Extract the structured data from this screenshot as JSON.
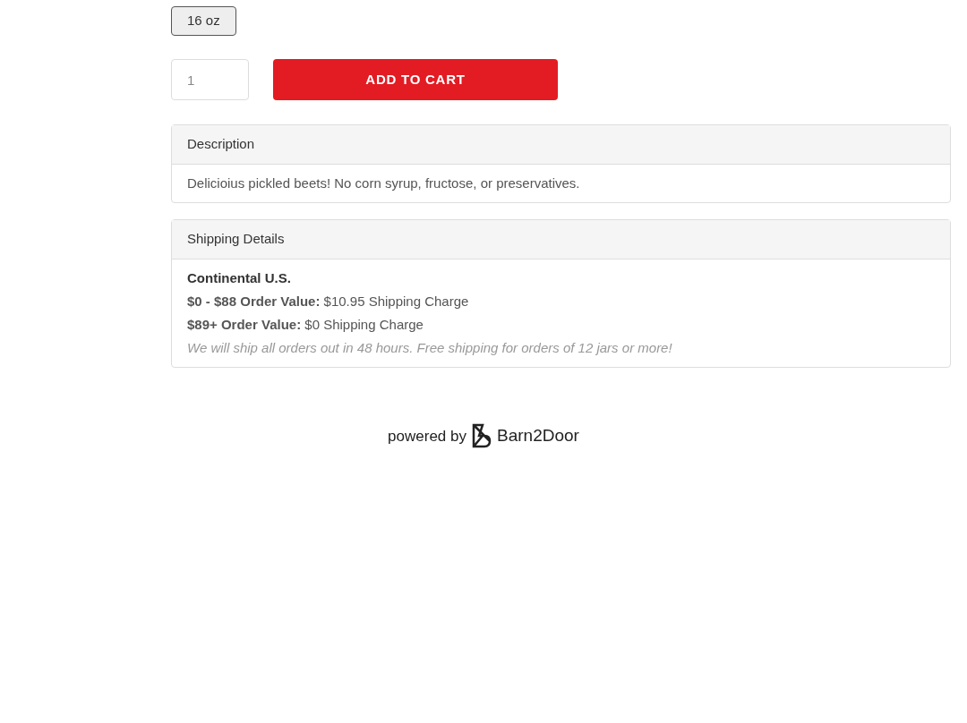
{
  "variants": [
    {
      "label": "16 oz",
      "selected": true
    }
  ],
  "quantity": {
    "value": "1"
  },
  "add_to_cart": "ADD TO CART",
  "panels": [
    {
      "title": "Description",
      "lines": [
        {
          "kind": "plain",
          "text": "Delicioius pickled beets! No corn syrup, fructose, or preservatives."
        }
      ]
    },
    {
      "title": "Shipping Details",
      "lines": [
        {
          "kind": "heading",
          "text": "Continental U.S."
        },
        {
          "kind": "plain",
          "text": "**$0 - $88 Order Value:** $10.95 Shipping Charge"
        },
        {
          "kind": "plain",
          "text": "**$89+ Order Value:** $0 Shipping Charge"
        },
        {
          "kind": "note",
          "text": "We will ship all orders out in 48 hours. Free shipping for orders of 12 jars or more!"
        }
      ]
    }
  ],
  "footer": {
    "powered_by": "powered by",
    "brand": "Barn2Door"
  }
}
